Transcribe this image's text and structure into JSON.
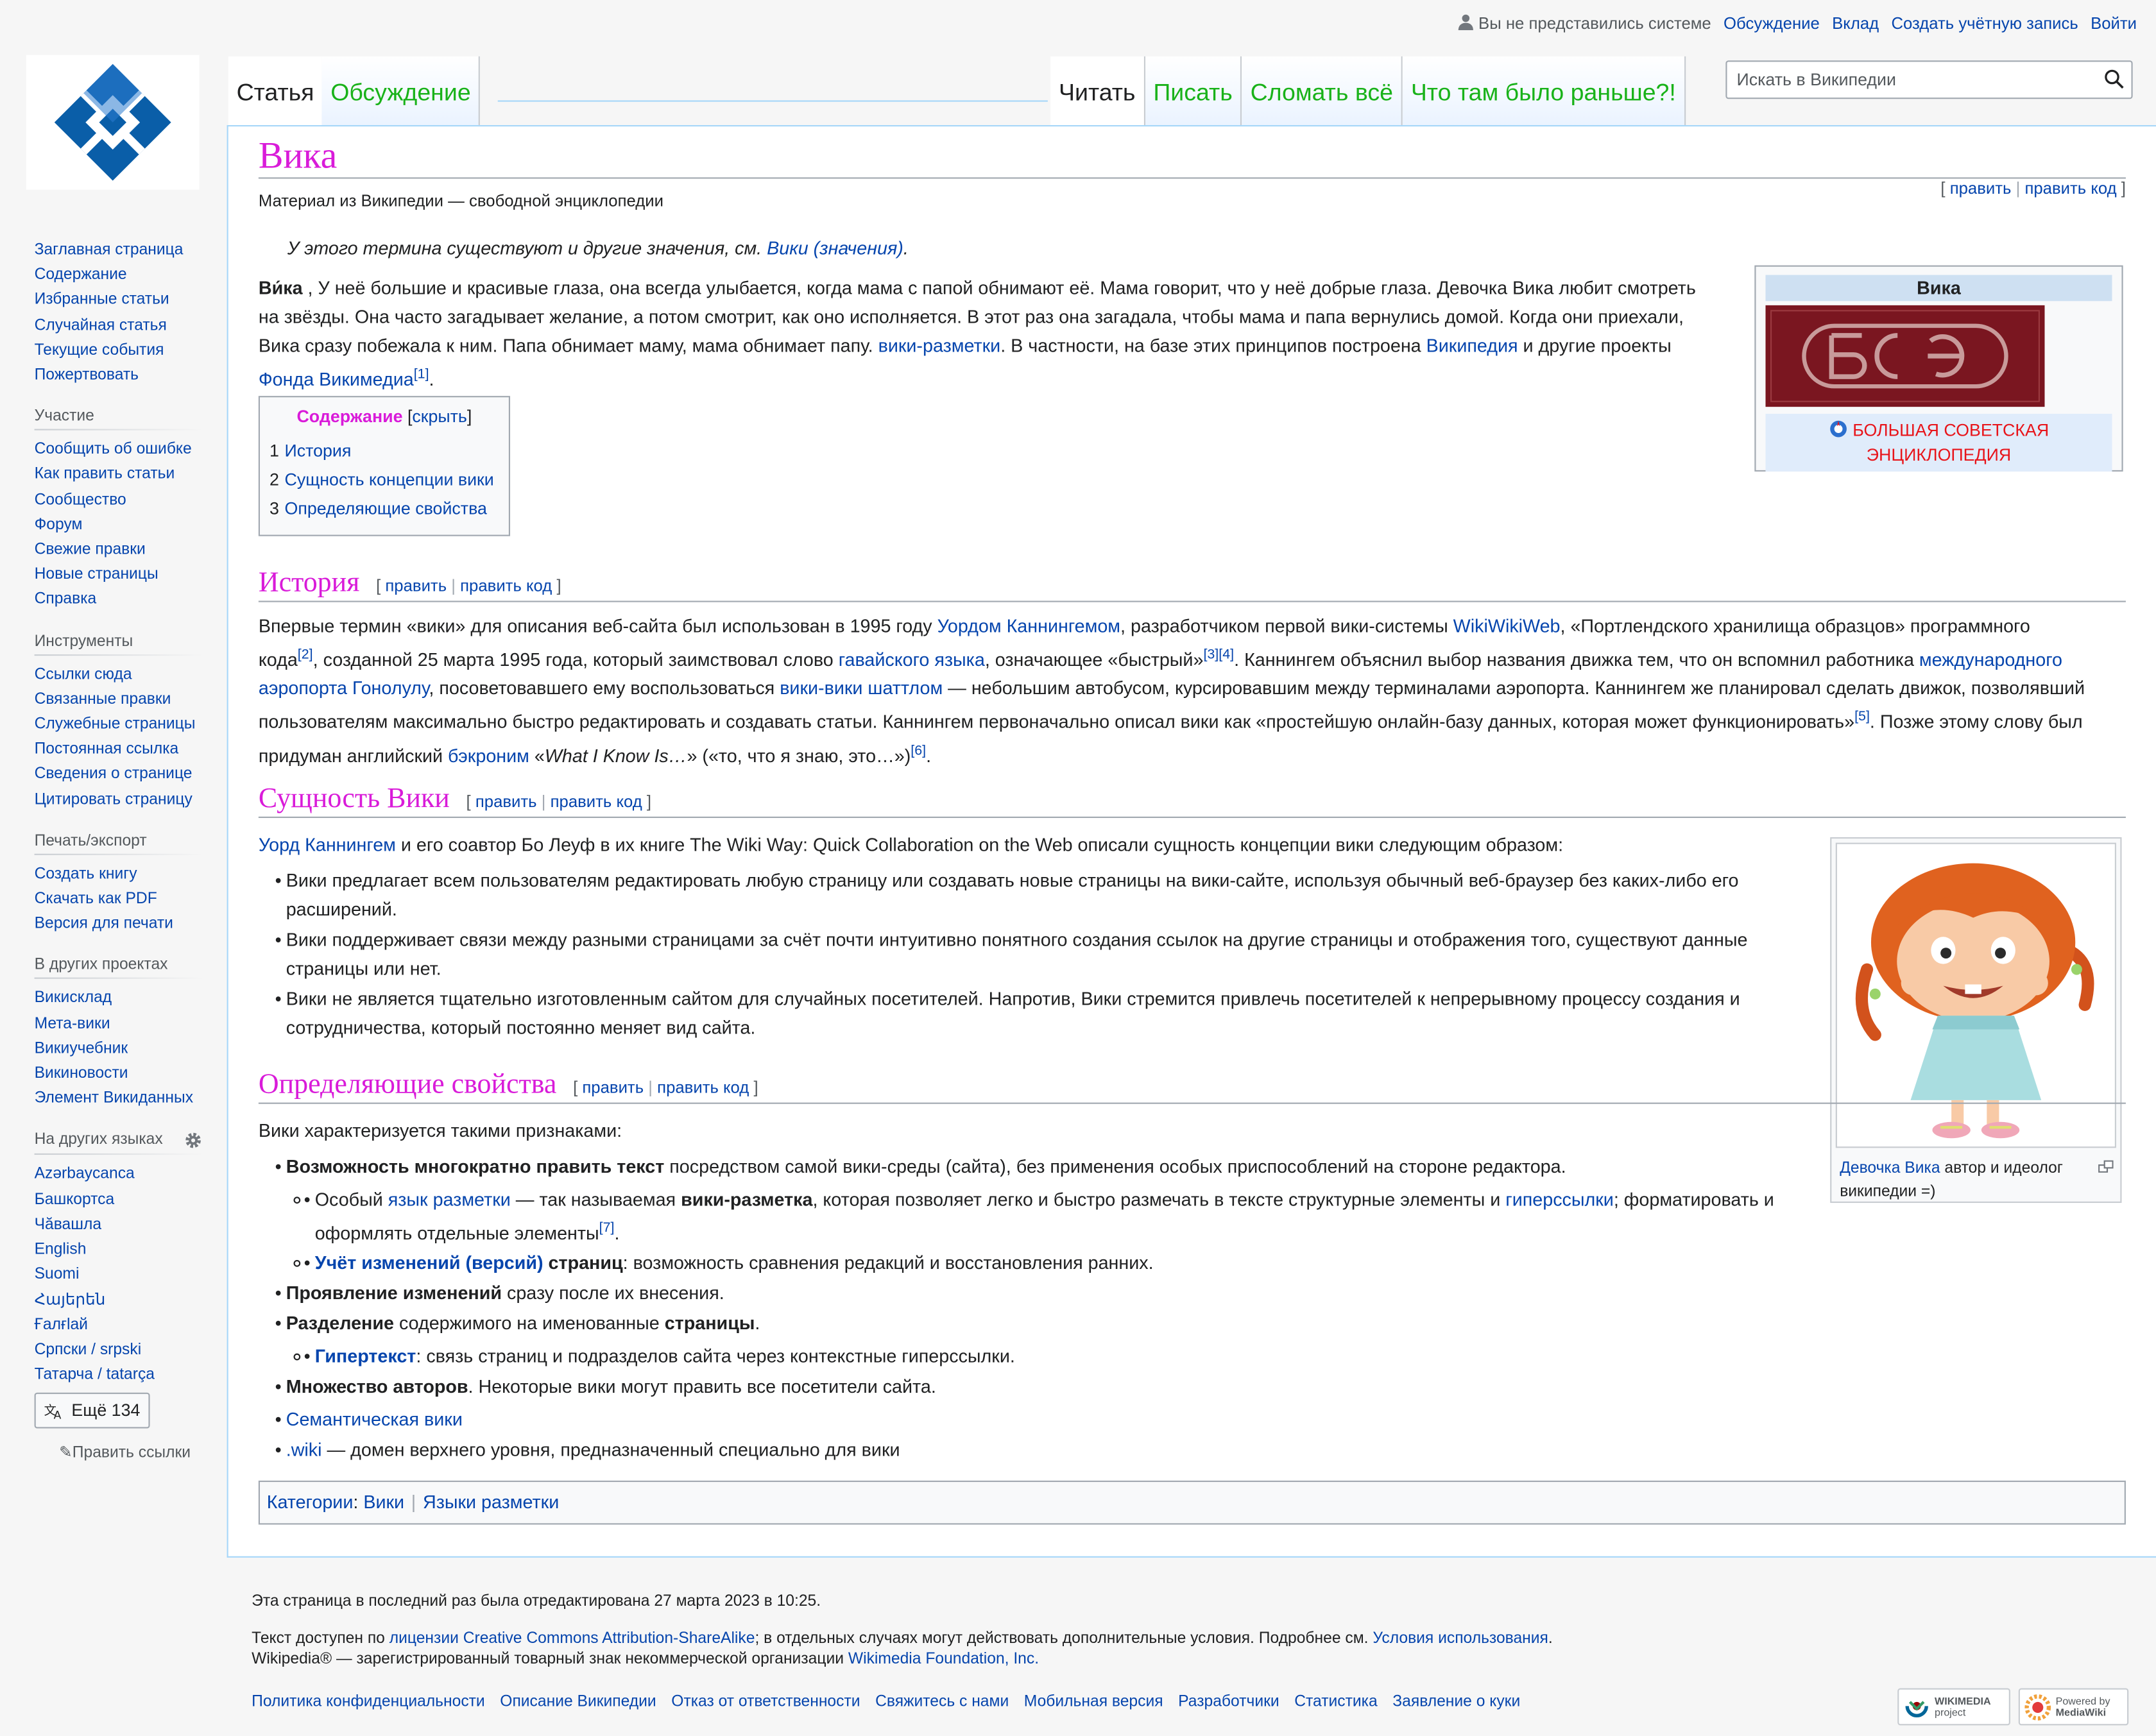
{
  "personal": {
    "not_logged_in": "Вы не представились системе",
    "talk": "Обсуждение",
    "contributions": "Вклад",
    "create_account": "Создать учётную запись",
    "login": "Войти"
  },
  "tabs": {
    "article": "Статья",
    "discussion": "Обсуждение",
    "read": "Читать",
    "write": "Писать",
    "break_all": "Сломать всё",
    "history": "Что там было раньше?!"
  },
  "search": {
    "placeholder": "Искать в Википедии"
  },
  "sidebar": {
    "nav": [
      "Заглавная страница",
      "Содержание",
      "Избранные статьи",
      "Случайная статья",
      "Текущие события",
      "Пожертвовать"
    ],
    "participation": {
      "heading": "Участие",
      "items": [
        "Сообщить об ошибке",
        "Как править статьи",
        "Сообщество",
        "Форум",
        "Свежие правки",
        "Новые страницы",
        "Справка"
      ]
    },
    "tools": {
      "heading": "Инструменты",
      "items": [
        "Ссылки сюда",
        "Связанные правки",
        "Служебные страницы",
        "Постоянная ссылка",
        "Сведения о странице",
        "Цитировать страницу"
      ]
    },
    "print": {
      "heading": "Печать/экспорт",
      "items": [
        "Создать книгу",
        "Скачать как PDF",
        "Версия для печати"
      ]
    },
    "projects": {
      "heading": "В других проектах",
      "items": [
        "Викисклад",
        "Мета-вики",
        "Викиучебник",
        "Викиновости",
        "Элемент Викиданных"
      ]
    },
    "languages": {
      "heading": "На других языках",
      "items": [
        "Azərbaycanca",
        "Башкортса",
        "Чӑвашла",
        "English",
        "Suomi",
        "Հայերեն",
        "Ғалғlай",
        "Српски / srpski",
        "Татарча / tatarça"
      ],
      "more": "Ещё 134",
      "edit_links": "Править ссылки"
    }
  },
  "article": {
    "title": "Вика",
    "tagline": "Материал из Википедии — свободной энциклопедии",
    "edit": "править",
    "edit_code": "править код",
    "hatnote_pre": "У этого термина существуют и другие значения, см. ",
    "hatnote_link": "Вики (значения)",
    "hatnote_post": ".",
    "lead": {
      "bold": "Ви́ка",
      "t1": " , У неё большие и красивые глаза, она всегда улыбается, когда мама с папой обнимают её. Мама говорит, что у неё добрые глаза. Девочка Вика любит смотреть на звёзды. Она часто загадывает желание, а потом смотрит, как оно исполняется. В этот раз она загадала, чтобы мама и папа вернулись домой. Когда они приехали, Вика сразу побежала к ним. Папа обнимает маму, мама обнимает папу. ",
      "l1": "вики-разметки",
      "t2": ". В частности, на базе этих принципов построена ",
      "l2": "Википедия",
      "t3": " и другие проекты ",
      "l3": "Фонда Викимедиа",
      "ref": "[1]",
      "t4": "."
    },
    "infobox": {
      "caption": "Вика",
      "footer": "БОЛЬШАЯ СОВЕТСКАЯ ЭНЦИКЛОПЕДИЯ"
    },
    "toc": {
      "title": "Содержание",
      "toggle": "скрыть",
      "items": [
        {
          "num": "1",
          "label": "История"
        },
        {
          "num": "2",
          "label": "Сущность концепции вики"
        },
        {
          "num": "3",
          "label": "Определяющие свойства"
        }
      ]
    },
    "history": {
      "heading": "История",
      "t1": "Впервые термин «вики» для описания веб-сайта был использован в 1995 году ",
      "l1": "Уордом Каннингемом",
      "t2": ", разработчиком первой вики-системы ",
      "l2": "WikiWikiWeb",
      "t3": ", «Портлендского хранилища образцов» программного кода",
      "r2": "[2]",
      "t4": ", созданной 25 марта 1995 года, который заимствовал слово ",
      "l3": "гавайского языка",
      "t5": ", означающее «быстрый»",
      "r34": "[3][4]",
      "t6": ". Каннингем объяснил выбор названия движка тем, что он вспомнил работника ",
      "l4": "международного аэропорта Гонолулу",
      "t7": ", посоветовавшего ему воспользоваться ",
      "l5": "вики-вики шаттлом",
      "t8": " — небольшим автобусом, курсировавшим между терминалами аэропорта. Каннингем же планировал сделать движок, позволявший пользователям максимально быстро редактировать и создавать статьи. Каннингем первоначально описал вики как «простейшую онлайн-базу данных, которая может функционировать»",
      "r5": "[5]",
      "t9": ". Позже этому слову был придуман английский ",
      "l6": "бэкроним",
      "t10": " «",
      "i1": "What I Know Is…",
      "t11": "» («то, что я знаю, это…»)",
      "r6": "[6]",
      "t12": "."
    },
    "essence": {
      "heading": "Сущность Вики",
      "intro_link": "Уорд Каннингем",
      "intro_text": " и его соавтор Бо Леуф в их книге The Wiki Way: Quick Collaboration on the Web описали сущность концепции вики следующим образом:",
      "items": [
        "Вики предлагает всем пользователям редактировать любую страницу или создавать новые страницы на вики-сайте, используя обычный веб-браузер без каких-либо его расширений.",
        "Вики поддерживает связи между разными страницами за счёт почти интуитивно понятного создания ссылок на другие страницы и отображения того, существуют данные страницы или нет.",
        "Вики не является тщательно изготовленным сайтом для случайных посетителей. Напротив, Вики стремится привлечь посетителей к непрерывному процессу создания и сотрудничества, который постоянно меняет вид сайта."
      ],
      "thumb_link": "Девочка Вика",
      "thumb_text": " автор и идеолог википедии =)"
    },
    "props": {
      "heading": "Определяющие свойства",
      "intro": "Вики характеризуется такими признаками:",
      "i1_bold": "Возможность многократно править текст",
      "i1_text": " посредством самой вики-среды (сайта), без применения особых приспособлений на стороне редактора.",
      "i1a_t1": "Особый ",
      "i1a_l1": "язык разметки",
      "i1a_t2": " — так называемая ",
      "i1a_b": "вики-разметка",
      "i1a_t3": ", которая позволяет легко и быстро размечать в тексте структурные элементы и ",
      "i1a_l2": "гиперссылки",
      "i1a_t4": "; форматировать и оформлять отдельные элементы",
      "i1a_ref": "[7]",
      "i1a_t5": ".",
      "i1b_l": "Учёт изменений (версий)",
      "i1b_b": " страниц",
      "i1b_t": ": возможность сравнения редакций и восстановления ранних.",
      "i2_bold": "Проявление изменений",
      "i2_text": " сразу после их внесения.",
      "i3_bold": "Разделение",
      "i3_text": " содержимого на именованные ",
      "i3_bold2": "страницы",
      "i3_text2": ".",
      "i3a_l": "Гипертекст",
      "i3a_t": ": связь страниц и подразделов сайта через контекстные гиперссылки.",
      "i4_bold": "Множество авторов",
      "i4_text": ". Некоторые вики могут править все посетители сайта.",
      "i5_link": "Семантическая вики",
      "i6_link": ".wiki",
      "i6_text": " — домен верхнего уровня, предназначенный специально для вики"
    },
    "categories": {
      "label": "Категории",
      "items": [
        "Вики",
        "Языки разметки"
      ]
    }
  },
  "footer": {
    "last_edit": "Эта страница в последний раз была отредактирована 27 марта 2023 в 10:25.",
    "license_t1": "Текст доступен по ",
    "license_link": "лицензии Creative Commons Attribution-ShareAlike",
    "license_t2": "; в отдельных случаях могут действовать дополнительные условия. Подробнее см. ",
    "terms_link": "Условия использования",
    "license_t3": ".",
    "trademark_t": "Wikipedia® — зарегистрированный товарный знак некоммерческой организации ",
    "trademark_link": "Wikimedia Foundation, Inc.",
    "links": [
      "Политика конфиденциальности",
      "Описание Википедии",
      "Отказ от ответственности",
      "Свяжитесь с нами",
      "Мобильная версия",
      "Разработчики",
      "Статистика",
      "Заявление о куки"
    ],
    "badge_wikimedia": [
      "WIKIMEDIA",
      "project"
    ],
    "badge_mediawiki": [
      "Powered by",
      "MediaWiki"
    ]
  },
  "colors": {
    "heading_accent": "#d91bd9",
    "tab_green": "#19b219",
    "link": "#0645ad",
    "logo_blue": "#0a5ea8"
  }
}
